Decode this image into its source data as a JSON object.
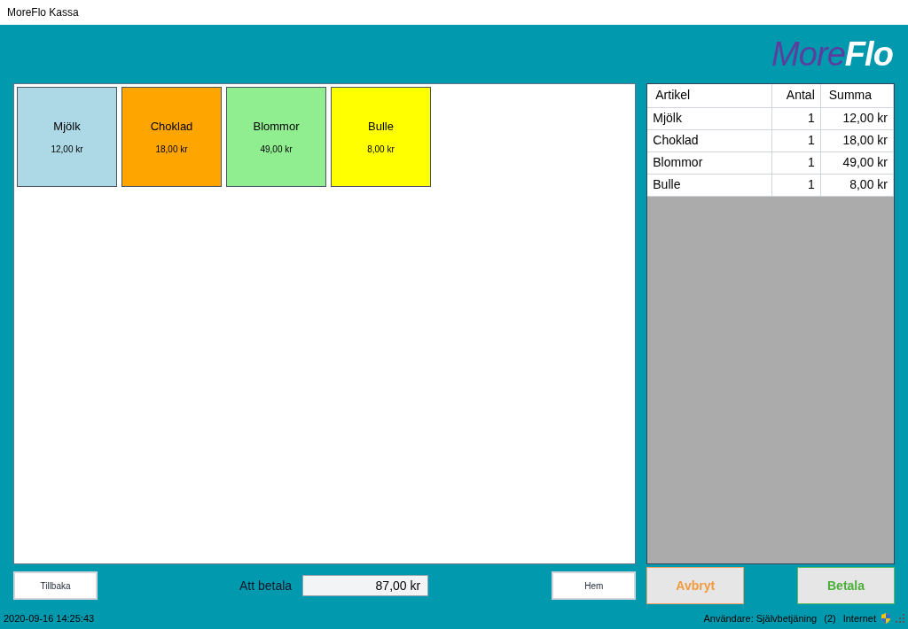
{
  "window": {
    "title": "MoreFlo Kassa"
  },
  "logo": {
    "part_1": "More",
    "part_2": "Flo"
  },
  "products": [
    {
      "name": "Mjölk",
      "price": "12,00 kr",
      "color": "#add8e6"
    },
    {
      "name": "Choklad",
      "price": "18,00 kr",
      "color": "#ffa500"
    },
    {
      "name": "Blommor",
      "price": "49,00 kr",
      "color": "#90ee90"
    },
    {
      "name": "Bulle",
      "price": "8,00 kr",
      "color": "#ffff00"
    }
  ],
  "table": {
    "columns": [
      "Artikel",
      "Antal",
      "Summa"
    ],
    "rows": [
      [
        "Mjölk",
        "1",
        "12,00 kr"
      ],
      [
        "Choklad",
        "1",
        "18,00 kr"
      ],
      [
        "Blommor",
        "1",
        "49,00 kr"
      ],
      [
        "Bulle",
        "1",
        "8,00 kr"
      ]
    ]
  },
  "buttons": {
    "back": "Tillbaka",
    "home": "Hem",
    "cancel": "Avbryt",
    "pay": "Betala"
  },
  "total": {
    "label": "Att betala",
    "value": "87,00 kr"
  },
  "status_bar": {
    "datetime": "2020-09-16 14:25:43",
    "user": "Användare: Självbetjäning",
    "count": "(2)",
    "zone": "Internet"
  }
}
